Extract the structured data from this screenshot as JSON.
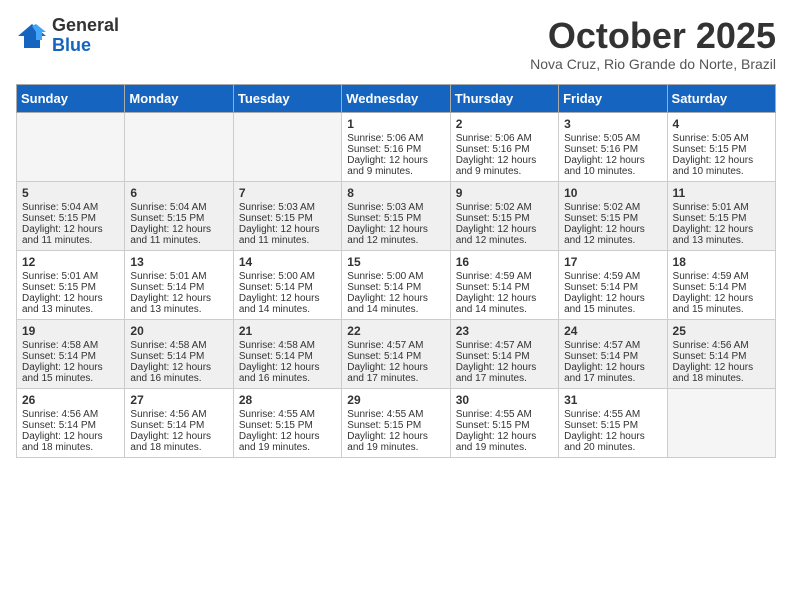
{
  "logo": {
    "general": "General",
    "blue": "Blue"
  },
  "title": "October 2025",
  "location": "Nova Cruz, Rio Grande do Norte, Brazil",
  "days_of_week": [
    "Sunday",
    "Monday",
    "Tuesday",
    "Wednesday",
    "Thursday",
    "Friday",
    "Saturday"
  ],
  "weeks": [
    [
      {
        "day": "",
        "content": ""
      },
      {
        "day": "",
        "content": ""
      },
      {
        "day": "",
        "content": ""
      },
      {
        "day": "1",
        "content": "Sunrise: 5:06 AM\nSunset: 5:16 PM\nDaylight: 12 hours\nand 9 minutes."
      },
      {
        "day": "2",
        "content": "Sunrise: 5:06 AM\nSunset: 5:16 PM\nDaylight: 12 hours\nand 9 minutes."
      },
      {
        "day": "3",
        "content": "Sunrise: 5:05 AM\nSunset: 5:16 PM\nDaylight: 12 hours\nand 10 minutes."
      },
      {
        "day": "4",
        "content": "Sunrise: 5:05 AM\nSunset: 5:15 PM\nDaylight: 12 hours\nand 10 minutes."
      }
    ],
    [
      {
        "day": "5",
        "content": "Sunrise: 5:04 AM\nSunset: 5:15 PM\nDaylight: 12 hours\nand 11 minutes."
      },
      {
        "day": "6",
        "content": "Sunrise: 5:04 AM\nSunset: 5:15 PM\nDaylight: 12 hours\nand 11 minutes."
      },
      {
        "day": "7",
        "content": "Sunrise: 5:03 AM\nSunset: 5:15 PM\nDaylight: 12 hours\nand 11 minutes."
      },
      {
        "day": "8",
        "content": "Sunrise: 5:03 AM\nSunset: 5:15 PM\nDaylight: 12 hours\nand 12 minutes."
      },
      {
        "day": "9",
        "content": "Sunrise: 5:02 AM\nSunset: 5:15 PM\nDaylight: 12 hours\nand 12 minutes."
      },
      {
        "day": "10",
        "content": "Sunrise: 5:02 AM\nSunset: 5:15 PM\nDaylight: 12 hours\nand 12 minutes."
      },
      {
        "day": "11",
        "content": "Sunrise: 5:01 AM\nSunset: 5:15 PM\nDaylight: 12 hours\nand 13 minutes."
      }
    ],
    [
      {
        "day": "12",
        "content": "Sunrise: 5:01 AM\nSunset: 5:15 PM\nDaylight: 12 hours\nand 13 minutes."
      },
      {
        "day": "13",
        "content": "Sunrise: 5:01 AM\nSunset: 5:14 PM\nDaylight: 12 hours\nand 13 minutes."
      },
      {
        "day": "14",
        "content": "Sunrise: 5:00 AM\nSunset: 5:14 PM\nDaylight: 12 hours\nand 14 minutes."
      },
      {
        "day": "15",
        "content": "Sunrise: 5:00 AM\nSunset: 5:14 PM\nDaylight: 12 hours\nand 14 minutes."
      },
      {
        "day": "16",
        "content": "Sunrise: 4:59 AM\nSunset: 5:14 PM\nDaylight: 12 hours\nand 14 minutes."
      },
      {
        "day": "17",
        "content": "Sunrise: 4:59 AM\nSunset: 5:14 PM\nDaylight: 12 hours\nand 15 minutes."
      },
      {
        "day": "18",
        "content": "Sunrise: 4:59 AM\nSunset: 5:14 PM\nDaylight: 12 hours\nand 15 minutes."
      }
    ],
    [
      {
        "day": "19",
        "content": "Sunrise: 4:58 AM\nSunset: 5:14 PM\nDaylight: 12 hours\nand 15 minutes."
      },
      {
        "day": "20",
        "content": "Sunrise: 4:58 AM\nSunset: 5:14 PM\nDaylight: 12 hours\nand 16 minutes."
      },
      {
        "day": "21",
        "content": "Sunrise: 4:58 AM\nSunset: 5:14 PM\nDaylight: 12 hours\nand 16 minutes."
      },
      {
        "day": "22",
        "content": "Sunrise: 4:57 AM\nSunset: 5:14 PM\nDaylight: 12 hours\nand 17 minutes."
      },
      {
        "day": "23",
        "content": "Sunrise: 4:57 AM\nSunset: 5:14 PM\nDaylight: 12 hours\nand 17 minutes."
      },
      {
        "day": "24",
        "content": "Sunrise: 4:57 AM\nSunset: 5:14 PM\nDaylight: 12 hours\nand 17 minutes."
      },
      {
        "day": "25",
        "content": "Sunrise: 4:56 AM\nSunset: 5:14 PM\nDaylight: 12 hours\nand 18 minutes."
      }
    ],
    [
      {
        "day": "26",
        "content": "Sunrise: 4:56 AM\nSunset: 5:14 PM\nDaylight: 12 hours\nand 18 minutes."
      },
      {
        "day": "27",
        "content": "Sunrise: 4:56 AM\nSunset: 5:14 PM\nDaylight: 12 hours\nand 18 minutes."
      },
      {
        "day": "28",
        "content": "Sunrise: 4:55 AM\nSunset: 5:15 PM\nDaylight: 12 hours\nand 19 minutes."
      },
      {
        "day": "29",
        "content": "Sunrise: 4:55 AM\nSunset: 5:15 PM\nDaylight: 12 hours\nand 19 minutes."
      },
      {
        "day": "30",
        "content": "Sunrise: 4:55 AM\nSunset: 5:15 PM\nDaylight: 12 hours\nand 19 minutes."
      },
      {
        "day": "31",
        "content": "Sunrise: 4:55 AM\nSunset: 5:15 PM\nDaylight: 12 hours\nand 20 minutes."
      },
      {
        "day": "",
        "content": ""
      }
    ]
  ]
}
